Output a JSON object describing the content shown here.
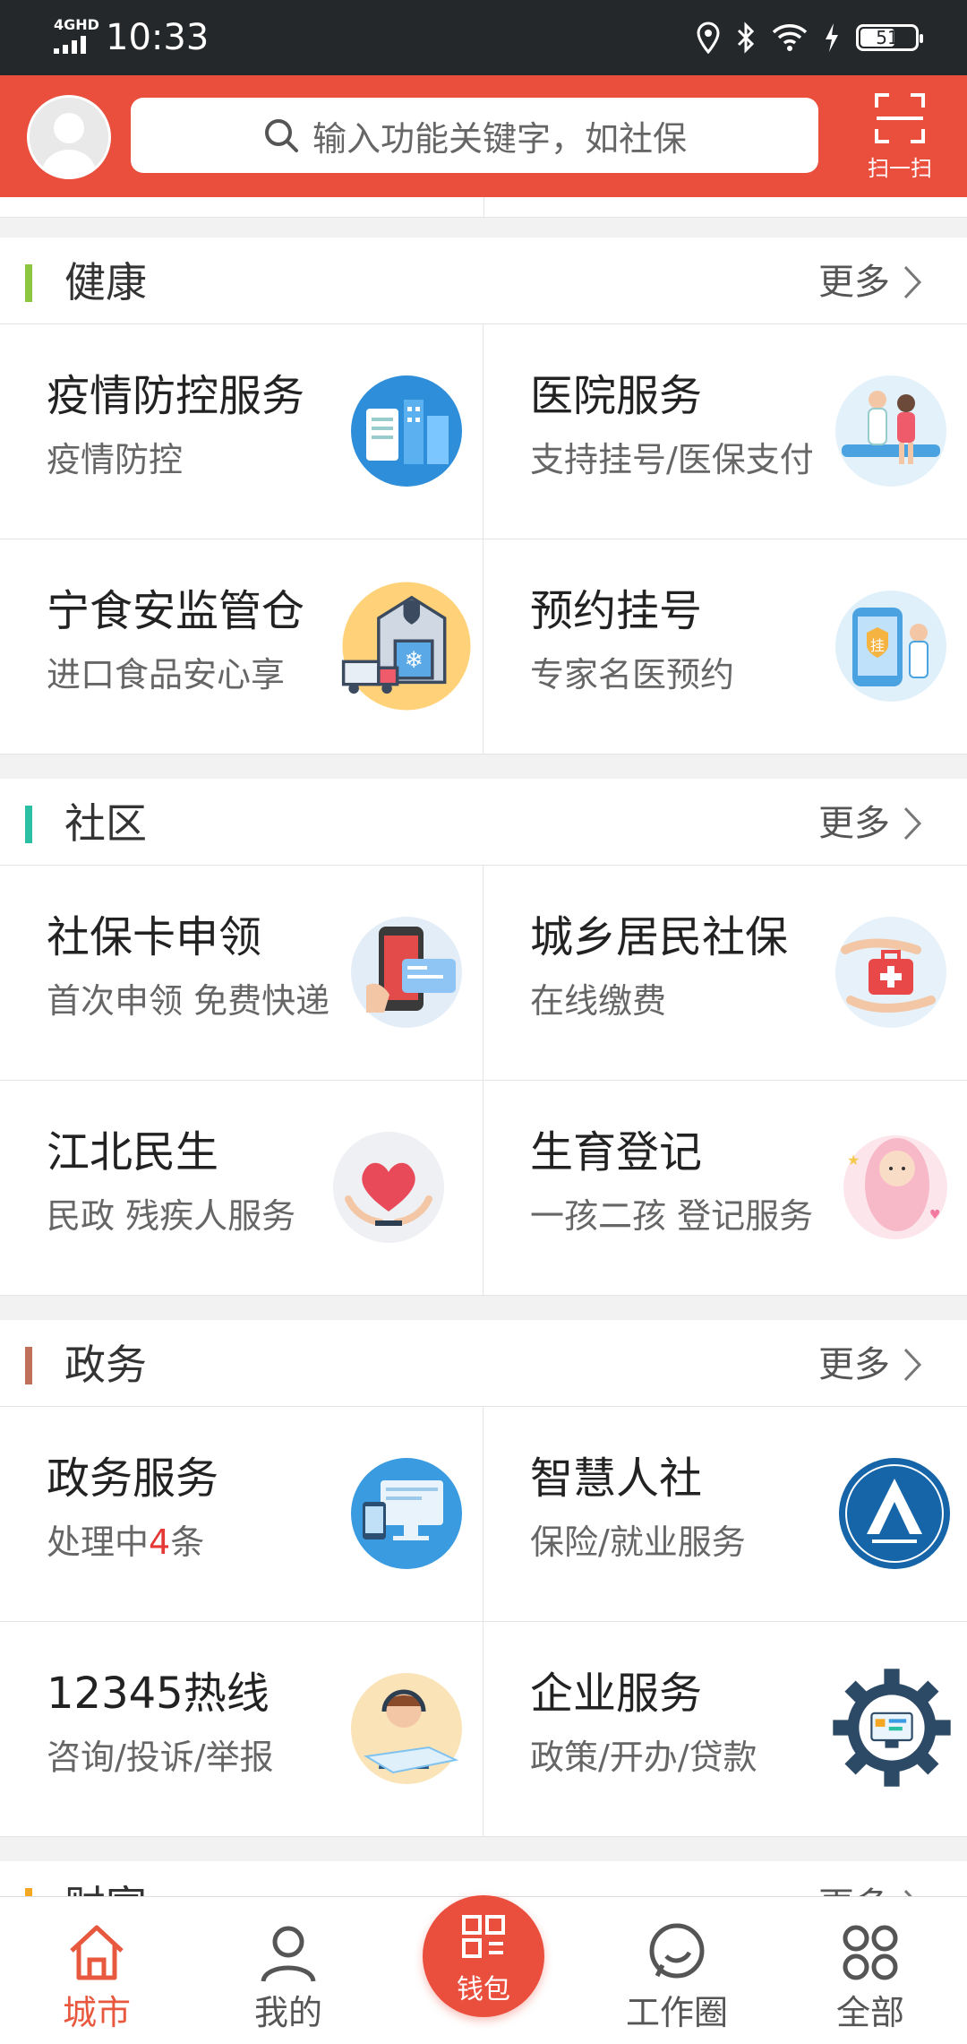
{
  "status_bar": {
    "network": "4GHD",
    "time": "10:33",
    "battery": "51"
  },
  "header": {
    "search_placeholder": "输入功能关键字，如社保",
    "scan_label": "扫一扫"
  },
  "sections": [
    {
      "title": "健康",
      "more": "更多",
      "accent": "#8cc63f",
      "items": [
        {
          "title": "疫情防控服务",
          "subtitle": "疫情防控",
          "icon": "city-buildings-icon"
        },
        {
          "title": "医院服务",
          "subtitle": "支持挂号/医保支付",
          "icon": "doctor-patient-icon"
        },
        {
          "title": "宁食安监管仓",
          "subtitle": "进口食品安心享",
          "icon": "cold-storage-truck-icon"
        },
        {
          "title": "预约挂号",
          "subtitle": "专家名医预约",
          "icon": "phone-doctor-icon"
        }
      ]
    },
    {
      "title": "社区",
      "more": "更多",
      "accent": "#2bbfa4",
      "items": [
        {
          "title": "社保卡申领",
          "subtitle": "首次申领 免费快递",
          "icon": "phone-card-icon"
        },
        {
          "title": "城乡居民社保",
          "subtitle": "在线缴费",
          "icon": "medical-kit-icon"
        },
        {
          "title": "江北民生",
          "subtitle": "民政  残疾人服务",
          "icon": "heart-hands-icon"
        },
        {
          "title": "生育登记",
          "subtitle": "一孩二孩 登记服务",
          "icon": "baby-icon"
        }
      ]
    },
    {
      "title": "政务",
      "more": "更多",
      "accent": "#c0705a",
      "items": [
        {
          "title": "政务服务",
          "subtitle_pre": "处理中",
          "subtitle_num": "4",
          "subtitle_post": "条",
          "icon": "computer-devices-icon"
        },
        {
          "title": "智慧人社",
          "subtitle": "保险/就业服务",
          "icon": "hrss-logo-icon"
        },
        {
          "title": "12345热线",
          "subtitle": "咨询/投诉/举报",
          "icon": "hotline-agent-icon"
        },
        {
          "title": "企业服务",
          "subtitle": "政策/开办/贷款",
          "icon": "gear-screen-icon"
        }
      ]
    },
    {
      "title": "财富",
      "more": "更多",
      "accent": "#f5a623"
    }
  ],
  "tabbar": {
    "city": "城市",
    "mine": "我的",
    "wallet": "钱包",
    "work": "工作圈",
    "all": "全部"
  },
  "colors": {
    "brand": "#ea4e3d",
    "active_tab": "#e8583f"
  }
}
